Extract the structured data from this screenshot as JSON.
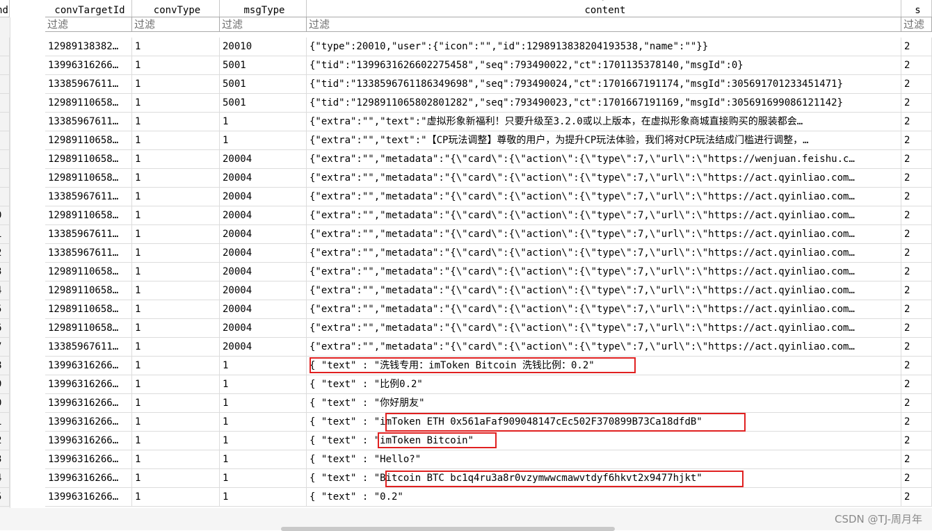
{
  "columns": [
    "nd",
    "convTargetId",
    "convType",
    "msgType",
    "content",
    "s"
  ],
  "filter_placeholder": "过滤",
  "rows": [
    {
      "num": "",
      "target": "12989138382…",
      "convType": "1",
      "msgType": "20010",
      "content": "{\"type\":20010,\"user\":{\"icon\":\"\",\"id\":1298913838204193538,\"name\":\"\"}}",
      "s": "2"
    },
    {
      "num": "",
      "target": "13996316266…",
      "convType": "1",
      "msgType": "5001",
      "content": "{\"tid\":\"1399631626602275458\",\"seq\":793490022,\"ct\":1701135378140,\"msgId\":0}",
      "s": "2"
    },
    {
      "num": "",
      "target": "13385967611…",
      "convType": "1",
      "msgType": "5001",
      "content": "{\"tid\":\"1338596761186349698\",\"seq\":793490024,\"ct\":1701667191174,\"msgId\":305691701233451471}",
      "s": "2"
    },
    {
      "num": "",
      "target": "12989110658…",
      "convType": "1",
      "msgType": "5001",
      "content": "{\"tid\":\"1298911065802801282\",\"seq\":793490023,\"ct\":1701667191169,\"msgId\":305691699086121142}",
      "s": "2"
    },
    {
      "num": "",
      "target": "13385967611…",
      "convType": "1",
      "msgType": "1",
      "content": "{\"extra\":\"\",\"text\":\"虚拟形象新福利！只要升级至3.2.0或以上版本，在虚拟形象商城直接购买的服装都会…",
      "s": "2"
    },
    {
      "num": "",
      "target": "12989110658…",
      "convType": "1",
      "msgType": "1",
      "content": "{\"extra\":\"\",\"text\":\"【CP玩法调整】尊敬的用户，为提升CP玩法体验，我们将对CP玩法结成门槛进行调整，…",
      "s": "2"
    },
    {
      "num": "",
      "target": "12989110658…",
      "convType": "1",
      "msgType": "20004",
      "content": "{\"extra\":\"\",\"metadata\":\"{\\\"card\\\":{\\\"action\\\":{\\\"type\\\":7,\\\"url\\\":\\\"https://wenjuan.feishu.c…",
      "s": "2"
    },
    {
      "num": "",
      "target": "12989110658…",
      "convType": "1",
      "msgType": "20004",
      "content": "{\"extra\":\"\",\"metadata\":\"{\\\"card\\\":{\\\"action\\\":{\\\"type\\\":7,\\\"url\\\":\\\"https://act.qyinliao.com…",
      "s": "2"
    },
    {
      "num": "",
      "target": "13385967611…",
      "convType": "1",
      "msgType": "20004",
      "content": "{\"extra\":\"\",\"metadata\":\"{\\\"card\\\":{\\\"action\\\":{\\\"type\\\":7,\\\"url\\\":\\\"https://act.qyinliao.com…",
      "s": "2"
    },
    {
      "num": "0",
      "target": "12989110658…",
      "convType": "1",
      "msgType": "20004",
      "content": "{\"extra\":\"\",\"metadata\":\"{\\\"card\\\":{\\\"action\\\":{\\\"type\\\":7,\\\"url\\\":\\\"https://act.qyinliao.com…",
      "s": "2"
    },
    {
      "num": "1",
      "target": "13385967611…",
      "convType": "1",
      "msgType": "20004",
      "content": "{\"extra\":\"\",\"metadata\":\"{\\\"card\\\":{\\\"action\\\":{\\\"type\\\":7,\\\"url\\\":\\\"https://act.qyinliao.com…",
      "s": "2"
    },
    {
      "num": "2",
      "target": "13385967611…",
      "convType": "1",
      "msgType": "20004",
      "content": "{\"extra\":\"\",\"metadata\":\"{\\\"card\\\":{\\\"action\\\":{\\\"type\\\":7,\\\"url\\\":\\\"https://act.qyinliao.com…",
      "s": "2"
    },
    {
      "num": "3",
      "target": "12989110658…",
      "convType": "1",
      "msgType": "20004",
      "content": "{\"extra\":\"\",\"metadata\":\"{\\\"card\\\":{\\\"action\\\":{\\\"type\\\":7,\\\"url\\\":\\\"https://act.qyinliao.com…",
      "s": "2"
    },
    {
      "num": "4",
      "target": "12989110658…",
      "convType": "1",
      "msgType": "20004",
      "content": "{\"extra\":\"\",\"metadata\":\"{\\\"card\\\":{\\\"action\\\":{\\\"type\\\":7,\\\"url\\\":\\\"https://act.qyinliao.com…",
      "s": "2"
    },
    {
      "num": "5",
      "target": "12989110658…",
      "convType": "1",
      "msgType": "20004",
      "content": "{\"extra\":\"\",\"metadata\":\"{\\\"card\\\":{\\\"action\\\":{\\\"type\\\":7,\\\"url\\\":\\\"https://act.qyinliao.com…",
      "s": "2"
    },
    {
      "num": "6",
      "target": "12989110658…",
      "convType": "1",
      "msgType": "20004",
      "content": "{\"extra\":\"\",\"metadata\":\"{\\\"card\\\":{\\\"action\\\":{\\\"type\\\":7,\\\"url\\\":\\\"https://act.qyinliao.com…",
      "s": "2"
    },
    {
      "num": "7",
      "target": "13385967611…",
      "convType": "1",
      "msgType": "20004",
      "content": "{\"extra\":\"\",\"metadata\":\"{\\\"card\\\":{\\\"action\\\":{\\\"type\\\":7,\\\"url\\\":\\\"https://act.qyinliao.com…",
      "s": "2"
    },
    {
      "num": "8",
      "target": "13996316266…",
      "convType": "1",
      "msgType": "1",
      "content": "{  \"text\" : \"洗钱专用：imToken Bitcoin 洗钱比例：0.2\"",
      "s": "2"
    },
    {
      "num": "9",
      "target": "13996316266…",
      "convType": "1",
      "msgType": "1",
      "content": "{  \"text\" : \"比例0.2\"",
      "s": "2"
    },
    {
      "num": "0",
      "target": "13996316266…",
      "convType": "1",
      "msgType": "1",
      "content": "{  \"text\" : \"你好朋友\"",
      "s": "2"
    },
    {
      "num": "1",
      "target": "13996316266…",
      "convType": "1",
      "msgType": "1",
      "content": "{  \"text\" : \"imToken ETH 0x561aFaf909048147cEc502F370899B73Ca18dfdB\"",
      "s": "2"
    },
    {
      "num": "2",
      "target": "13996316266…",
      "convType": "1",
      "msgType": "1",
      "content": "{  \"text\" : \"imToken Bitcoin\"",
      "s": "2"
    },
    {
      "num": "3",
      "target": "13996316266…",
      "convType": "1",
      "msgType": "1",
      "content": "{  \"text\" : \"Hello?\"",
      "s": "2"
    },
    {
      "num": "4",
      "target": "13996316266…",
      "convType": "1",
      "msgType": "1",
      "content": "{  \"text\" : \"Bitcoin BTC bc1q4ru3a8r0vzymwwcmawvtdyf6hkvt2x9477hjkt\"",
      "s": "2"
    },
    {
      "num": "5",
      "target": "13996316266…",
      "convType": "1",
      "msgType": "1",
      "content": "{  \"text\" : \"0.2\"",
      "s": "2"
    }
  ],
  "highlighted_rows": [
    17,
    20,
    21,
    23
  ],
  "watermark": "CSDN @TJ-周月年",
  "colors": {
    "highlight": "#e02020",
    "grid": "#dcdcdc"
  }
}
